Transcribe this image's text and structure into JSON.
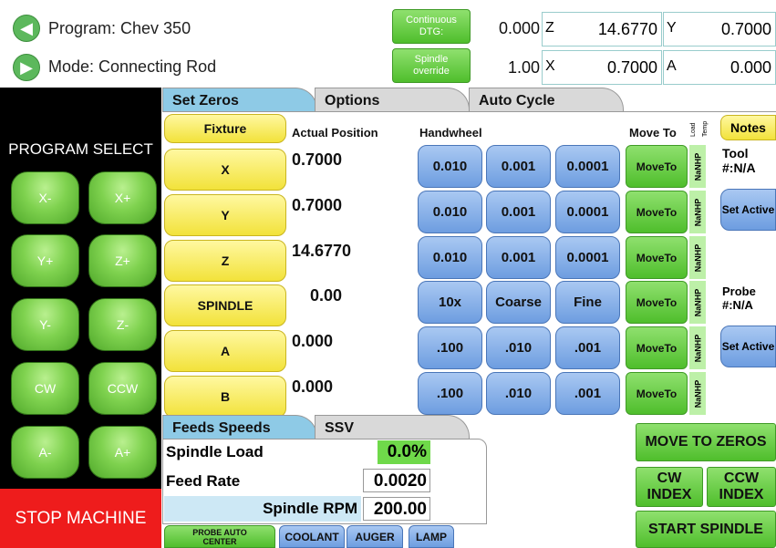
{
  "header": {
    "program_label": "Program: Chev 350",
    "mode_label": "Mode: Connecting Rod",
    "continuous_dtg_label": "Continuous DTG:",
    "continuous_dtg_value": "0.000",
    "spindle_override_label": "Spindle override",
    "spindle_override_value": "1.00",
    "dro": [
      {
        "axis": "Z",
        "value": "14.6770"
      },
      {
        "axis": "Y",
        "value": "0.7000"
      },
      {
        "axis": "X",
        "value": "0.7000"
      },
      {
        "axis": "A",
        "value": "0.000"
      }
    ]
  },
  "left": {
    "program_select": "PROGRAM SELECT",
    "jog": [
      "X-",
      "X+",
      "Y+",
      "Z+",
      "Y-",
      "Z-",
      "CW",
      "CCW",
      "A-",
      "A+"
    ],
    "stop": "STOP MACHINE"
  },
  "tabs": [
    "Set Zeros",
    "Options",
    "Auto Cycle"
  ],
  "setzeros": {
    "fixture": "Fixture",
    "col_actual": "Actual Position",
    "col_handwheel": "Handwheel",
    "col_moveto": "Move To",
    "col_load": "Load",
    "col_temp": "Temp",
    "notes": "Notes",
    "rows": [
      {
        "name": "X",
        "pos": "0.7000",
        "hw": [
          "0.010",
          "0.001",
          "0.0001"
        ],
        "move": "MoveTo",
        "nan": "NaNHP"
      },
      {
        "name": "Y",
        "pos": "0.7000",
        "hw": [
          "0.010",
          "0.001",
          "0.0001"
        ],
        "move": "MoveTo",
        "nan": "NaNHP"
      },
      {
        "name": "Z",
        "pos": "14.6770",
        "hw": [
          "0.010",
          "0.001",
          "0.0001"
        ],
        "move": "MoveTo",
        "nan": "NaNHP"
      },
      {
        "name": "SPINDLE",
        "pos": "0.00",
        "hw": [
          "10x",
          "Coarse",
          "Fine"
        ],
        "move": "MoveTo",
        "nan": "NaNHP"
      },
      {
        "name": "A",
        "pos": "0.000",
        "hw": [
          ".100",
          ".010",
          ".001"
        ],
        "move": "MoveTo",
        "nan": "NaNHP"
      },
      {
        "name": "B",
        "pos": "0.000",
        "hw": [
          ".100",
          ".010",
          ".001"
        ],
        "move": "MoveTo",
        "nan": "NaNHP"
      }
    ],
    "tool_label": "Tool",
    "tool_value": "#:N/A",
    "set_active_1": "Set Active",
    "probe_label": "Probe",
    "probe_value": "#:N/A",
    "set_active_2": "Set Active"
  },
  "feeds_tabs": [
    "Feeds Speeds",
    "SSV"
  ],
  "feeds": {
    "spindle_load_label": "Spindle Load",
    "spindle_load_value": "0.0%",
    "feed_rate_label": "Feed Rate",
    "feed_rate_value": "0.0020",
    "spindle_rpm_label": "Spindle RPM",
    "spindle_rpm_value": "200.00"
  },
  "bottom_buttons": {
    "probe_auto_center": "PROBE AUTO CENTER",
    "coolant": "COOLANT",
    "auger": "AUGER",
    "lamp": "LAMP"
  },
  "right_buttons": {
    "move_to_zeros": "MOVE TO ZEROS",
    "cw_index": "CW INDEX",
    "ccw_index": "CCW INDEX",
    "start_spindle": "START SPINDLE"
  },
  "colors": {
    "green": "#4fbe2c",
    "yellow": "#f2e23a",
    "blue": "#6d9de0",
    "red": "#ee1c1c",
    "tab_blue": "#8ecae6"
  }
}
